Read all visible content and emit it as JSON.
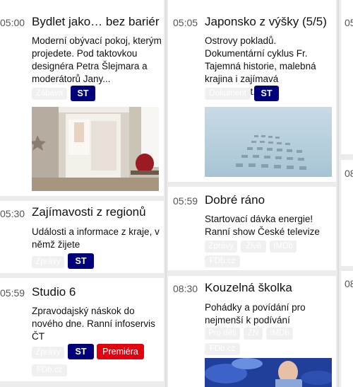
{
  "col1": {
    "programs": [
      {
        "time": "05:00",
        "title": "Bydlet jako… bez bariér",
        "desc_lines": [
          "Moderní obývací pokoj, kterým",
          "projedete. Pod taktovkou",
          "designéra Petra Šlejmara a",
          "moderátorů Jany..."
        ],
        "tags": [
          "Zábava"
        ],
        "channel": "ST"
      },
      {
        "time": "05:30",
        "title": "Zajímavosti z regionů",
        "desc_lines": [
          "Události a informace z kraje, v",
          "němž žijete"
        ],
        "tags": [
          "Zprávy"
        ],
        "channel": "ST"
      },
      {
        "time": "05:59",
        "title": "Studio 6",
        "desc_lines": [
          "Zpravodajský náskok do",
          "nového dne. Ranní infoservis",
          "ČT"
        ],
        "tags": [
          "Zprávy",
          "FDb.cz"
        ],
        "channel": "ST",
        "premiere": "Premiéra"
      }
    ]
  },
  "col2": {
    "programs": [
      {
        "time": "05:05",
        "title": "Japonsko z výšky (5/5)",
        "desc_lines": [
          "Ostrovy pokladů.",
          "Dokumentární cyklus Fr.",
          "Tajemná historie, malebná",
          "krajina i zajímavá současnost..."
        ],
        "tags": [
          "Dokument"
        ],
        "channel": "ST"
      },
      {
        "time": "05:59",
        "title": "Dobré ráno",
        "desc_lines": [
          "Startovací dávka energie!",
          "Ranní show České televize"
        ],
        "tags": [
          "Zprávy",
          "Živě",
          "IMDb",
          "FDb.cz"
        ]
      },
      {
        "time": "08:30",
        "title": "Kouzelná školka",
        "desc_lines": [
          "Pohádky a povídání pro",
          "nejmenší k podívání"
        ],
        "tags": [
          "Pro děti",
          "ZN",
          "IMDb",
          "FDb.cz"
        ]
      }
    ]
  },
  "col3": {
    "times": [
      "05",
      "08",
      "08"
    ]
  },
  "colors": {
    "channel_badge": "#00007a",
    "premiere_badge": "#e3000f",
    "page_bg": "#ebebeb"
  }
}
